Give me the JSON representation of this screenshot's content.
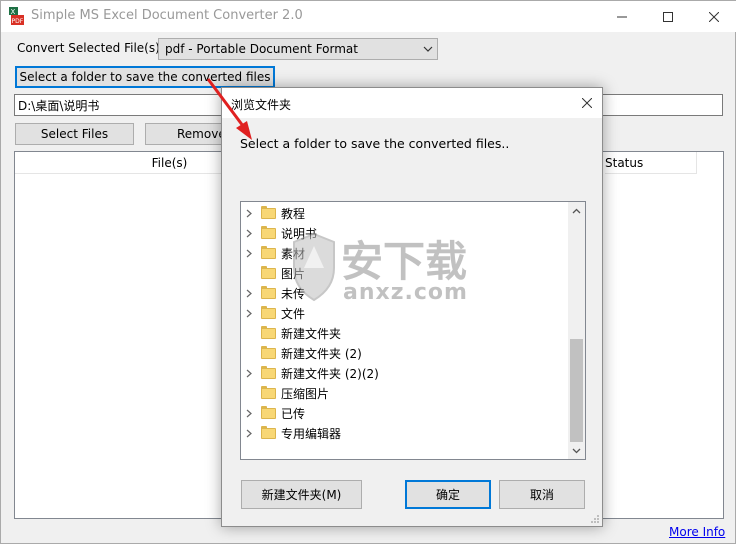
{
  "window": {
    "title": "Simple MS Excel Document Converter 2.0",
    "icon": "excel-pdf-app-icon",
    "controls": [
      "minimize-icon",
      "maximize-icon",
      "close-icon"
    ]
  },
  "main": {
    "convert_label": "Convert Selected File(s) To",
    "format_selected": "pdf - Portable Document Format",
    "select_folder_button": "Select a folder to save the converted files",
    "output_path": "D:\\桌面\\说明书",
    "select_files_button": "Select Files",
    "remove_button": "Remove A",
    "columns": {
      "files": "File(s)",
      "status": "Status"
    },
    "more_info_link": "More Info"
  },
  "dialog": {
    "title": "浏览文件夹",
    "description": "Select a folder to save the converted files..",
    "folders": [
      {
        "name": "教程",
        "expandable": true
      },
      {
        "name": "说明书",
        "expandable": true
      },
      {
        "name": "素材",
        "expandable": true
      },
      {
        "name": "图片",
        "expandable": false
      },
      {
        "name": "未传",
        "expandable": true
      },
      {
        "name": "文件",
        "expandable": true
      },
      {
        "name": "新建文件夹",
        "expandable": false
      },
      {
        "name": "新建文件夹 (2)",
        "expandable": false
      },
      {
        "name": "新建文件夹 (2)(2)",
        "expandable": true
      },
      {
        "name": "压缩图片",
        "expandable": false
      },
      {
        "name": "已传",
        "expandable": true
      },
      {
        "name": "专用编辑器",
        "expandable": true
      }
    ],
    "new_folder_button": "新建文件夹(M)",
    "ok_button": "确定",
    "cancel_button": "取消"
  },
  "watermark": {
    "brand": "安下载",
    "domain": "anxz.com"
  },
  "colors": {
    "focus_blue": "#0078d7",
    "arrow_red": "#e02020",
    "link": "#0000ee"
  }
}
